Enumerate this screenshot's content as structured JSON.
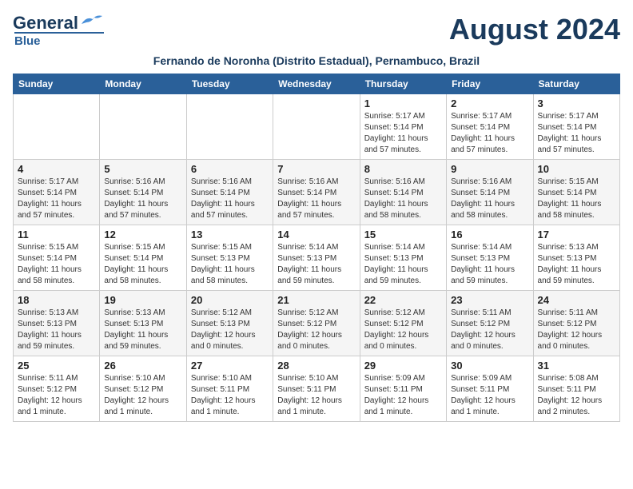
{
  "header": {
    "logo_general": "General",
    "logo_blue": "Blue",
    "month_title": "August 2024",
    "location": "Fernando de Noronha (Distrito Estadual), Pernambuco, Brazil"
  },
  "weekdays": [
    "Sunday",
    "Monday",
    "Tuesday",
    "Wednesday",
    "Thursday",
    "Friday",
    "Saturday"
  ],
  "weeks": [
    [
      {
        "day": "",
        "info": ""
      },
      {
        "day": "",
        "info": ""
      },
      {
        "day": "",
        "info": ""
      },
      {
        "day": "",
        "info": ""
      },
      {
        "day": "1",
        "info": "Sunrise: 5:17 AM\nSunset: 5:14 PM\nDaylight: 11 hours\nand 57 minutes."
      },
      {
        "day": "2",
        "info": "Sunrise: 5:17 AM\nSunset: 5:14 PM\nDaylight: 11 hours\nand 57 minutes."
      },
      {
        "day": "3",
        "info": "Sunrise: 5:17 AM\nSunset: 5:14 PM\nDaylight: 11 hours\nand 57 minutes."
      }
    ],
    [
      {
        "day": "4",
        "info": "Sunrise: 5:17 AM\nSunset: 5:14 PM\nDaylight: 11 hours\nand 57 minutes."
      },
      {
        "day": "5",
        "info": "Sunrise: 5:16 AM\nSunset: 5:14 PM\nDaylight: 11 hours\nand 57 minutes."
      },
      {
        "day": "6",
        "info": "Sunrise: 5:16 AM\nSunset: 5:14 PM\nDaylight: 11 hours\nand 57 minutes."
      },
      {
        "day": "7",
        "info": "Sunrise: 5:16 AM\nSunset: 5:14 PM\nDaylight: 11 hours\nand 57 minutes."
      },
      {
        "day": "8",
        "info": "Sunrise: 5:16 AM\nSunset: 5:14 PM\nDaylight: 11 hours\nand 58 minutes."
      },
      {
        "day": "9",
        "info": "Sunrise: 5:16 AM\nSunset: 5:14 PM\nDaylight: 11 hours\nand 58 minutes."
      },
      {
        "day": "10",
        "info": "Sunrise: 5:15 AM\nSunset: 5:14 PM\nDaylight: 11 hours\nand 58 minutes."
      }
    ],
    [
      {
        "day": "11",
        "info": "Sunrise: 5:15 AM\nSunset: 5:14 PM\nDaylight: 11 hours\nand 58 minutes."
      },
      {
        "day": "12",
        "info": "Sunrise: 5:15 AM\nSunset: 5:14 PM\nDaylight: 11 hours\nand 58 minutes."
      },
      {
        "day": "13",
        "info": "Sunrise: 5:15 AM\nSunset: 5:13 PM\nDaylight: 11 hours\nand 58 minutes."
      },
      {
        "day": "14",
        "info": "Sunrise: 5:14 AM\nSunset: 5:13 PM\nDaylight: 11 hours\nand 59 minutes."
      },
      {
        "day": "15",
        "info": "Sunrise: 5:14 AM\nSunset: 5:13 PM\nDaylight: 11 hours\nand 59 minutes."
      },
      {
        "day": "16",
        "info": "Sunrise: 5:14 AM\nSunset: 5:13 PM\nDaylight: 11 hours\nand 59 minutes."
      },
      {
        "day": "17",
        "info": "Sunrise: 5:13 AM\nSunset: 5:13 PM\nDaylight: 11 hours\nand 59 minutes."
      }
    ],
    [
      {
        "day": "18",
        "info": "Sunrise: 5:13 AM\nSunset: 5:13 PM\nDaylight: 11 hours\nand 59 minutes."
      },
      {
        "day": "19",
        "info": "Sunrise: 5:13 AM\nSunset: 5:13 PM\nDaylight: 11 hours\nand 59 minutes."
      },
      {
        "day": "20",
        "info": "Sunrise: 5:12 AM\nSunset: 5:13 PM\nDaylight: 12 hours\nand 0 minutes."
      },
      {
        "day": "21",
        "info": "Sunrise: 5:12 AM\nSunset: 5:12 PM\nDaylight: 12 hours\nand 0 minutes."
      },
      {
        "day": "22",
        "info": "Sunrise: 5:12 AM\nSunset: 5:12 PM\nDaylight: 12 hours\nand 0 minutes."
      },
      {
        "day": "23",
        "info": "Sunrise: 5:11 AM\nSunset: 5:12 PM\nDaylight: 12 hours\nand 0 minutes."
      },
      {
        "day": "24",
        "info": "Sunrise: 5:11 AM\nSunset: 5:12 PM\nDaylight: 12 hours\nand 0 minutes."
      }
    ],
    [
      {
        "day": "25",
        "info": "Sunrise: 5:11 AM\nSunset: 5:12 PM\nDaylight: 12 hours\nand 1 minute."
      },
      {
        "day": "26",
        "info": "Sunrise: 5:10 AM\nSunset: 5:12 PM\nDaylight: 12 hours\nand 1 minute."
      },
      {
        "day": "27",
        "info": "Sunrise: 5:10 AM\nSunset: 5:11 PM\nDaylight: 12 hours\nand 1 minute."
      },
      {
        "day": "28",
        "info": "Sunrise: 5:10 AM\nSunset: 5:11 PM\nDaylight: 12 hours\nand 1 minute."
      },
      {
        "day": "29",
        "info": "Sunrise: 5:09 AM\nSunset: 5:11 PM\nDaylight: 12 hours\nand 1 minute."
      },
      {
        "day": "30",
        "info": "Sunrise: 5:09 AM\nSunset: 5:11 PM\nDaylight: 12 hours\nand 1 minute."
      },
      {
        "day": "31",
        "info": "Sunrise: 5:08 AM\nSunset: 5:11 PM\nDaylight: 12 hours\nand 2 minutes."
      }
    ]
  ]
}
